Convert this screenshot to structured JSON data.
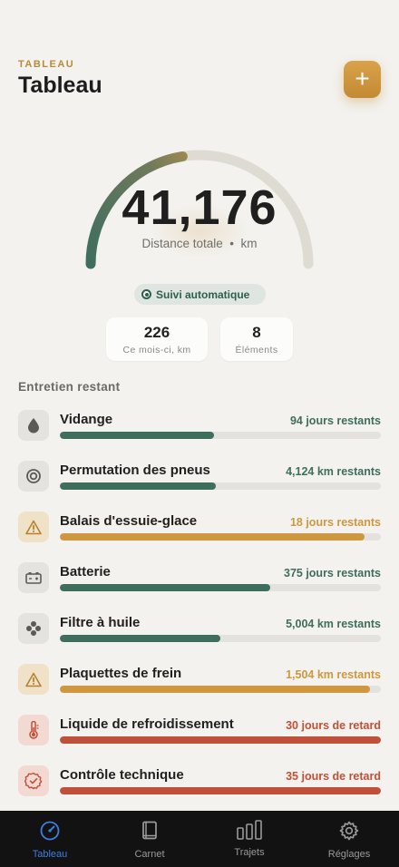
{
  "header": {
    "eyebrow": "TABLEAU",
    "title": "Tableau",
    "add_label": "+"
  },
  "odometer": {
    "value": "41,176",
    "caption": "Distance totale  •  km",
    "arc_progress": 0.45
  },
  "auto_tracking": {
    "label": "Suivi automatique"
  },
  "stats": [
    {
      "value": "226",
      "label": "Ce mois-ci, km"
    },
    {
      "value": "8",
      "label": "Éléments"
    }
  ],
  "section_title": "Entretien restant",
  "items": [
    {
      "name": "Vidange",
      "status": "94 jours restants",
      "progress": 0.48,
      "state": "ok",
      "icon": "droplet-icon"
    },
    {
      "name": "Permutation des pneus",
      "status": "4,124 km restants",
      "progress": 0.485,
      "state": "ok",
      "icon": "tire-icon"
    },
    {
      "name": "Balais d'essuie-glace",
      "status": "18 jours restants",
      "progress": 0.95,
      "state": "warn",
      "icon": "warning-icon"
    },
    {
      "name": "Batterie",
      "status": "375 jours restants",
      "progress": 0.655,
      "state": "ok",
      "icon": "battery-icon"
    },
    {
      "name": "Filtre à huile",
      "status": "5,004 km restants",
      "progress": 0.5,
      "state": "ok",
      "icon": "filter-icon"
    },
    {
      "name": "Plaquettes de frein",
      "status": "1,504 km restants",
      "progress": 0.965,
      "state": "warn",
      "icon": "warning-icon"
    },
    {
      "name": "Liquide de refroidissement",
      "status": "30 jours de retard",
      "progress": 1.0,
      "state": "late",
      "icon": "thermometer-icon"
    },
    {
      "name": "Contrôle technique",
      "status": "35 jours de retard",
      "progress": 1.0,
      "state": "late",
      "icon": "badge-check-icon"
    }
  ],
  "tabbar": [
    {
      "label": "Tableau",
      "icon": "speedometer-icon",
      "active": true
    },
    {
      "label": "Carnet",
      "icon": "book-icon",
      "active": false
    },
    {
      "label": "Trajets",
      "icon": "bars-icon",
      "active": false
    },
    {
      "label": "Réglages",
      "icon": "gear-icon",
      "active": false
    }
  ],
  "colors": {
    "ok": "#3f6e5f",
    "warn": "#cf973f",
    "late": "#c0503a",
    "accent": "#c38a33",
    "tab_active": "#3d7fe0",
    "tab_inactive": "#9a9a9a"
  }
}
